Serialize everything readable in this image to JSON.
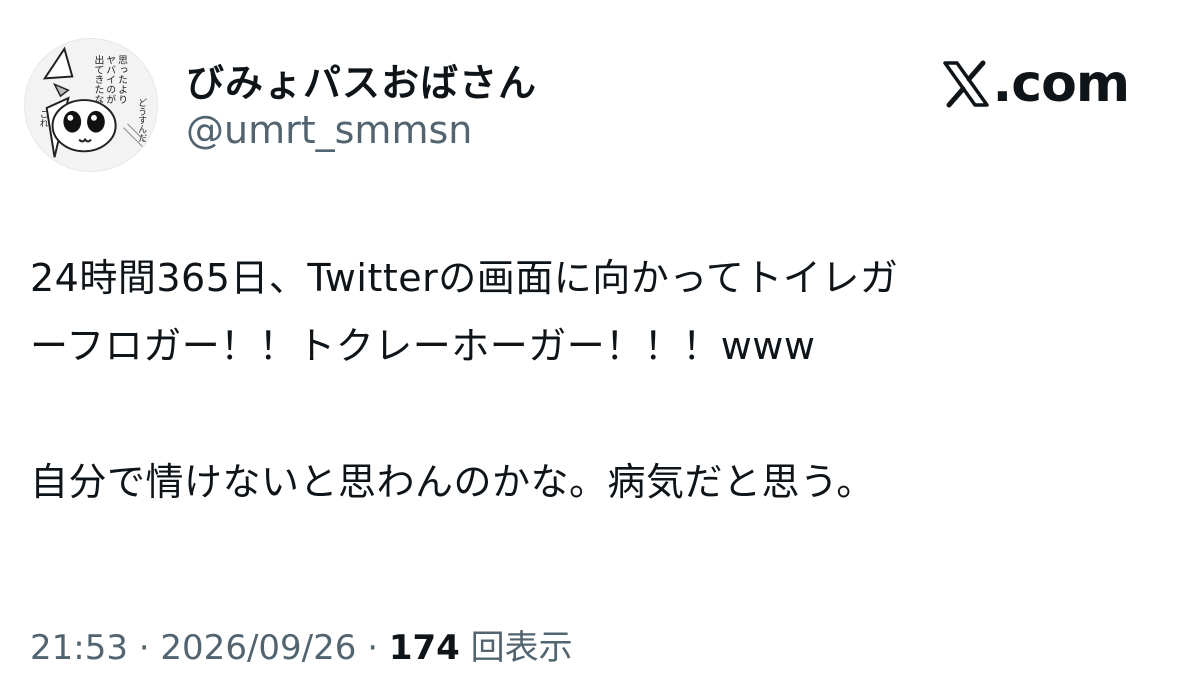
{
  "user": {
    "display_name": "びみょパスおばさん",
    "handle": "@umrt_smmsn",
    "avatar_icon": "manga-character-avatar-icon",
    "avatar_caption": [
      "思ったより",
      "ヤバイのが",
      "出てきたな",
      "どうすんだ",
      "これ"
    ]
  },
  "brand": {
    "icon": "x-logo-icon",
    "text": "com"
  },
  "tweet": {
    "lines": [
      "24時間365日、Twitterの画面に向かってトイレガ",
      "ーフロガー！！トクレーホーガー！！！www",
      "自分で情けないと思わんのかな。病気だと思う。"
    ]
  },
  "meta": {
    "time": "21:53",
    "separator": "·",
    "date": "2026/09/26",
    "views": "174",
    "views_label": "回表示"
  },
  "colors": {
    "text": "#0f1419",
    "secondary": "#536471",
    "background": "#ffffff"
  }
}
